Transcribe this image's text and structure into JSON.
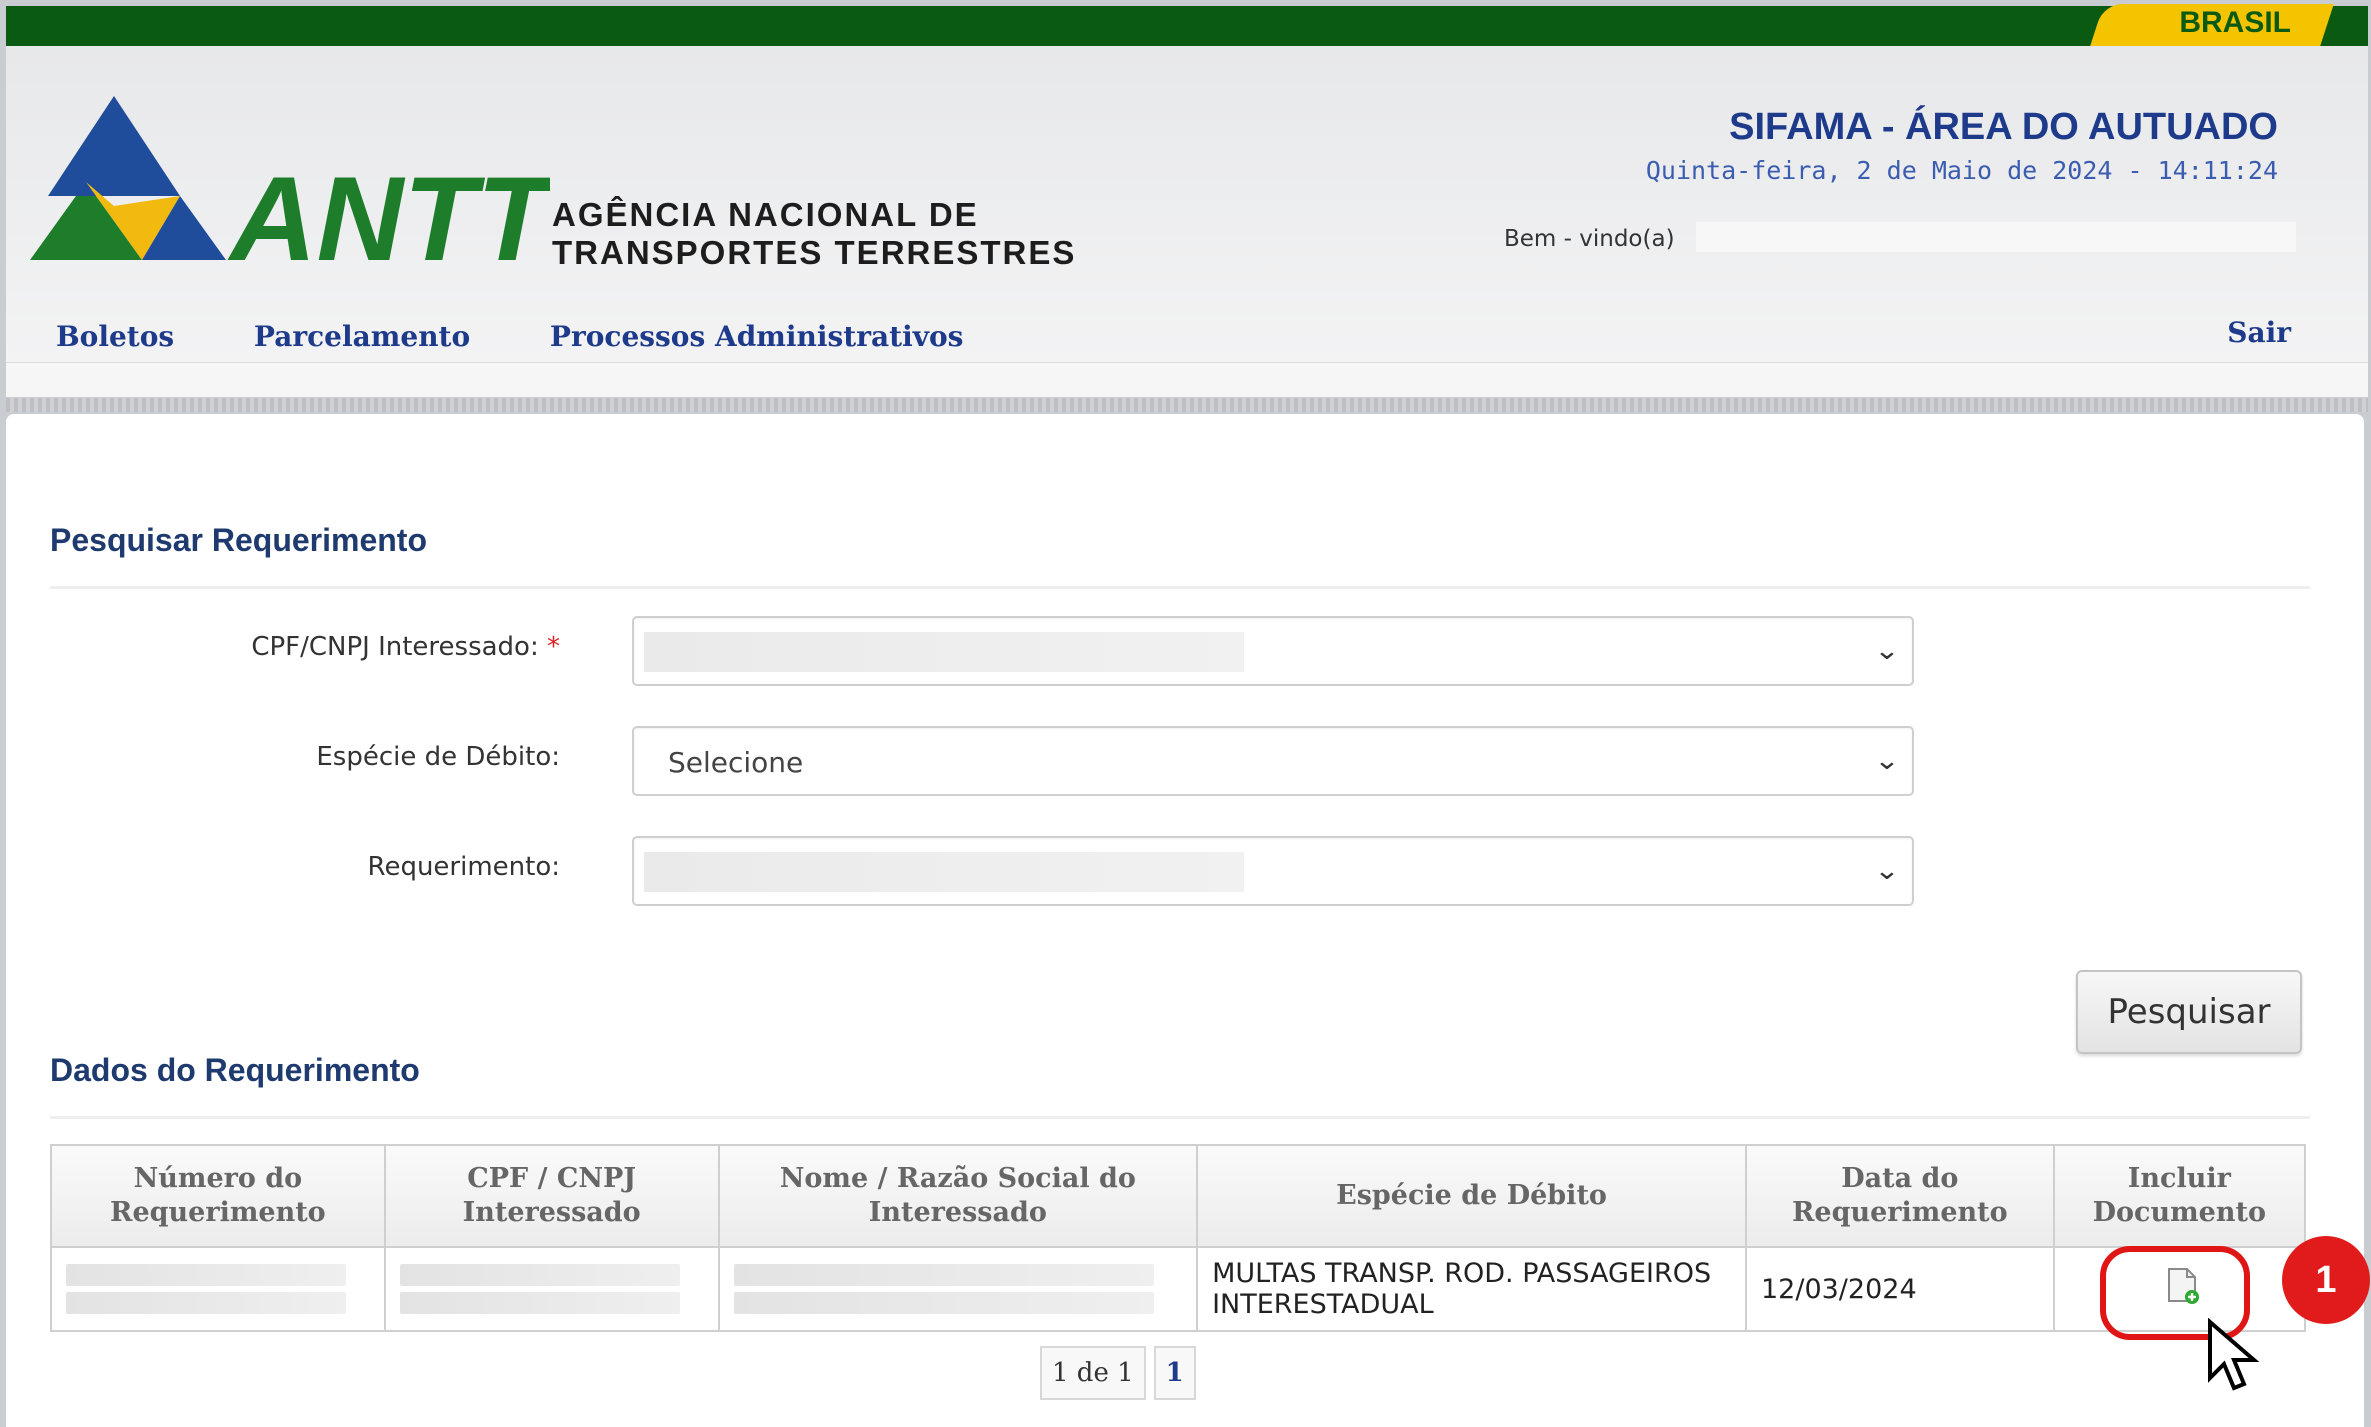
{
  "header": {
    "brand_flag": "BRASIL",
    "logo_text": "ANTT",
    "agency_line1": "AGÊNCIA NACIONAL DE",
    "agency_line2": "TRANSPORTES TERRESTRES",
    "system_title": "SIFAMA - ÁREA DO AUTUADO",
    "datetime": "Quinta-feira, 2 de Maio de 2024 - 14:11:24",
    "welcome": "Bem - vindo(a)"
  },
  "menu": {
    "items": [
      "Boletos",
      "Parcelamento",
      "Processos Administrativos"
    ],
    "logout": "Sair"
  },
  "search": {
    "title": "Pesquisar Requerimento",
    "cpf_label": "CPF/CNPJ Interessado:",
    "required_mark": "*",
    "especie_label": "Espécie de Débito:",
    "especie_value": "Selecione",
    "requerimento_label": "Requerimento:",
    "button": "Pesquisar"
  },
  "results": {
    "title": "Dados do Requerimento",
    "columns": [
      "Número do Requerimento",
      "CPF / CNPJ Interessado",
      "Nome / Razão Social do Interessado",
      "Espécie de Débito",
      "Data do Requerimento",
      "Incluir Documento"
    ],
    "rows": [
      {
        "especie": "MULTAS TRANSP. ROD. PASSAGEIROS INTERESTADUAL",
        "data": "12/03/2024"
      }
    ],
    "pager_info": "1 de 1",
    "pager_page": "1"
  },
  "annotation": {
    "step_badge": "1"
  },
  "colors": {
    "brand_green": "#0a5a12",
    "brand_yellow": "#f5c400",
    "title_blue": "#1e3a8a",
    "highlight_red": "#e01616"
  }
}
